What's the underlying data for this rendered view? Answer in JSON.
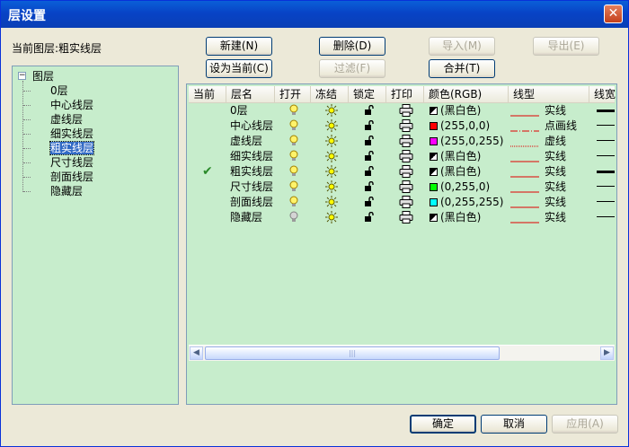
{
  "window": {
    "title": "层设置",
    "close_label": "✕"
  },
  "current_layer_label": "当前图层:粗实线层",
  "buttons": {
    "new": "新建(N)",
    "delete": "删除(D)",
    "import": "导入(M)",
    "export": "导出(E)",
    "set_current": "设为当前(C)",
    "filter": "过滤(F)",
    "merge": "合并(T)",
    "ok": "确定",
    "cancel": "取消",
    "apply": "应用(A)"
  },
  "tree": {
    "root": "图层",
    "items": [
      "0层",
      "中心线层",
      "虚线层",
      "细实线层",
      "粗实线层",
      "尺寸线层",
      "剖面线层",
      "隐藏层"
    ],
    "selected_index": 4
  },
  "table": {
    "headers": [
      "当前",
      "层名",
      "打开",
      "冻结",
      "锁定",
      "打印",
      "颜色(RGB)",
      "线型",
      "线宽"
    ],
    "rows": [
      {
        "current": "",
        "name": "0层",
        "on": true,
        "color_text": "(黑白色)",
        "color": "bw",
        "linetype": "实线",
        "lt": "solid",
        "lw": "thick"
      },
      {
        "current": "",
        "name": "中心线层",
        "on": true,
        "color_text": "(255,0,0)",
        "color": "#ff0000",
        "linetype": "点画线",
        "lt": "dashdot",
        "lw": "thin"
      },
      {
        "current": "",
        "name": "虚线层",
        "on": true,
        "color_text": "(255,0,255)",
        "color": "#ff00ff",
        "linetype": "虚线",
        "lt": "dotted",
        "lw": "thin"
      },
      {
        "current": "",
        "name": "细实线层",
        "on": true,
        "color_text": "(黑白色)",
        "color": "bw",
        "linetype": "实线",
        "lt": "solid",
        "lw": "thin"
      },
      {
        "current": "✔",
        "name": "粗实线层",
        "on": true,
        "color_text": "(黑白色)",
        "color": "bw",
        "linetype": "实线",
        "lt": "solid",
        "lw": "thick"
      },
      {
        "current": "",
        "name": "尺寸线层",
        "on": true,
        "color_text": "(0,255,0)",
        "color": "#00ff00",
        "linetype": "实线",
        "lt": "solid",
        "lw": "thin"
      },
      {
        "current": "",
        "name": "剖面线层",
        "on": true,
        "color_text": "(0,255,255)",
        "color": "#00ffff",
        "linetype": "实线",
        "lt": "solid",
        "lw": "thin"
      },
      {
        "current": "",
        "name": "隐藏层",
        "on": false,
        "color_text": "(黑白色)",
        "color": "bw",
        "linetype": "实线",
        "lt": "solid",
        "lw": "thin"
      }
    ]
  },
  "colors": {
    "accent_green_bg": "#c7edcc",
    "check": "#2a8a2a",
    "linetype_red": "#e00000"
  }
}
